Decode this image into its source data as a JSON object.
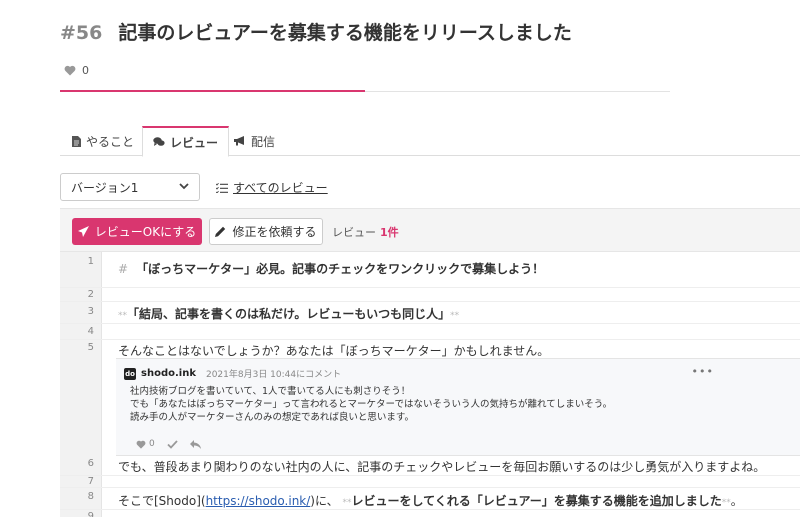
{
  "article": {
    "number": "#56",
    "title": "記事のレビュアーを募集する機能をリリースしました",
    "likes": "0",
    "progress": 0.5
  },
  "tabs": [
    {
      "label": "やること",
      "icon": "document-icon"
    },
    {
      "label": "レビュー",
      "icon": "comments-icon",
      "active": true
    },
    {
      "label": "配信",
      "icon": "megaphone-icon"
    }
  ],
  "version": {
    "selected": "バージョン1"
  },
  "all_reviews": {
    "label": "すべてのレビュー"
  },
  "toolbar": {
    "ok_label": "レビューOKにする",
    "fix_label": "修正を依頼する",
    "review_label": "レビュー",
    "review_count": "1件"
  },
  "lines": {
    "l1": {
      "num": "1",
      "hash": "#",
      "text": "「ぼっちマーケター」必見。記事のチェックをワンクリックで募集しよう！"
    },
    "l2": {
      "num": "2"
    },
    "l3": {
      "num": "3",
      "mark_open": "**",
      "text": "「結局、記事を書くのは私だけ。レビューもいつも同じ人」",
      "mark_close": "**"
    },
    "l4": {
      "num": "4"
    },
    "l5": {
      "num": "5",
      "text": "そんなことはないでしょうか？あなたは「ぼっちマーケター」かもしれません。"
    },
    "l6": {
      "num": "6",
      "text": "でも、普段あまり関わりのない社内の人に、記事のチェックやレビューを毎回お願いするのは少し勇気が入りますよね。"
    },
    "l7": {
      "num": "7"
    },
    "l8": {
      "num": "8",
      "prefix": "そこで[Shodo](",
      "url": "https://shodo.ink/",
      "mid": ")に、",
      "mark_open": "**",
      "strong": "レビューをしてくれる「レビュアー」を募集する機能を追加しました",
      "mark_close": "**",
      "end": "。"
    },
    "l9": {
      "num": "9"
    }
  },
  "comment": {
    "logo": "do",
    "author": "shodo.ink",
    "time": "2021年8月3日 10:44にコメント",
    "body_1": "社内技術ブログを書いていて、1人で書いてる人にも刺さりそう！",
    "body_2": "でも「あなたはぼっちマーケター」って言われるとマーケターではないそういう人の気持ちが離れてしまいそう。",
    "body_3": "読み手の人がマーケターさんのみの想定であれば良いと思います。",
    "likes": "0"
  }
}
